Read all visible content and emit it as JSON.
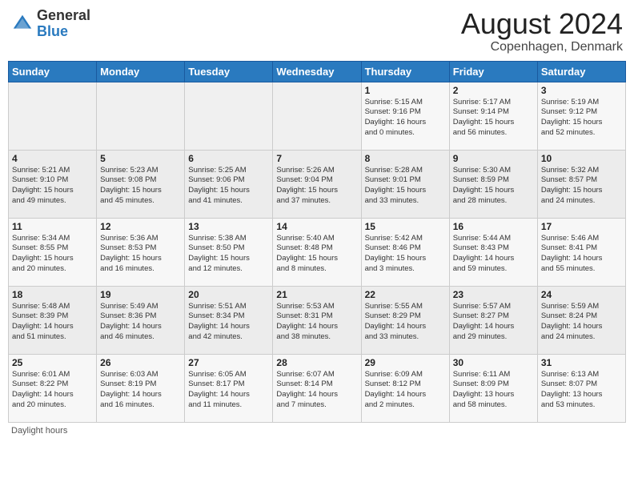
{
  "header": {
    "logo_general": "General",
    "logo_blue": "Blue",
    "month_year": "August 2024",
    "location": "Copenhagen, Denmark"
  },
  "days_of_week": [
    "Sunday",
    "Monday",
    "Tuesday",
    "Wednesday",
    "Thursday",
    "Friday",
    "Saturday"
  ],
  "weeks": [
    [
      {
        "day": "",
        "info": ""
      },
      {
        "day": "",
        "info": ""
      },
      {
        "day": "",
        "info": ""
      },
      {
        "day": "",
        "info": ""
      },
      {
        "day": "1",
        "info": "Sunrise: 5:15 AM\nSunset: 9:16 PM\nDaylight: 16 hours\nand 0 minutes."
      },
      {
        "day": "2",
        "info": "Sunrise: 5:17 AM\nSunset: 9:14 PM\nDaylight: 15 hours\nand 56 minutes."
      },
      {
        "day": "3",
        "info": "Sunrise: 5:19 AM\nSunset: 9:12 PM\nDaylight: 15 hours\nand 52 minutes."
      }
    ],
    [
      {
        "day": "4",
        "info": "Sunrise: 5:21 AM\nSunset: 9:10 PM\nDaylight: 15 hours\nand 49 minutes."
      },
      {
        "day": "5",
        "info": "Sunrise: 5:23 AM\nSunset: 9:08 PM\nDaylight: 15 hours\nand 45 minutes."
      },
      {
        "day": "6",
        "info": "Sunrise: 5:25 AM\nSunset: 9:06 PM\nDaylight: 15 hours\nand 41 minutes."
      },
      {
        "day": "7",
        "info": "Sunrise: 5:26 AM\nSunset: 9:04 PM\nDaylight: 15 hours\nand 37 minutes."
      },
      {
        "day": "8",
        "info": "Sunrise: 5:28 AM\nSunset: 9:01 PM\nDaylight: 15 hours\nand 33 minutes."
      },
      {
        "day": "9",
        "info": "Sunrise: 5:30 AM\nSunset: 8:59 PM\nDaylight: 15 hours\nand 28 minutes."
      },
      {
        "day": "10",
        "info": "Sunrise: 5:32 AM\nSunset: 8:57 PM\nDaylight: 15 hours\nand 24 minutes."
      }
    ],
    [
      {
        "day": "11",
        "info": "Sunrise: 5:34 AM\nSunset: 8:55 PM\nDaylight: 15 hours\nand 20 minutes."
      },
      {
        "day": "12",
        "info": "Sunrise: 5:36 AM\nSunset: 8:53 PM\nDaylight: 15 hours\nand 16 minutes."
      },
      {
        "day": "13",
        "info": "Sunrise: 5:38 AM\nSunset: 8:50 PM\nDaylight: 15 hours\nand 12 minutes."
      },
      {
        "day": "14",
        "info": "Sunrise: 5:40 AM\nSunset: 8:48 PM\nDaylight: 15 hours\nand 8 minutes."
      },
      {
        "day": "15",
        "info": "Sunrise: 5:42 AM\nSunset: 8:46 PM\nDaylight: 15 hours\nand 3 minutes."
      },
      {
        "day": "16",
        "info": "Sunrise: 5:44 AM\nSunset: 8:43 PM\nDaylight: 14 hours\nand 59 minutes."
      },
      {
        "day": "17",
        "info": "Sunrise: 5:46 AM\nSunset: 8:41 PM\nDaylight: 14 hours\nand 55 minutes."
      }
    ],
    [
      {
        "day": "18",
        "info": "Sunrise: 5:48 AM\nSunset: 8:39 PM\nDaylight: 14 hours\nand 51 minutes."
      },
      {
        "day": "19",
        "info": "Sunrise: 5:49 AM\nSunset: 8:36 PM\nDaylight: 14 hours\nand 46 minutes."
      },
      {
        "day": "20",
        "info": "Sunrise: 5:51 AM\nSunset: 8:34 PM\nDaylight: 14 hours\nand 42 minutes."
      },
      {
        "day": "21",
        "info": "Sunrise: 5:53 AM\nSunset: 8:31 PM\nDaylight: 14 hours\nand 38 minutes."
      },
      {
        "day": "22",
        "info": "Sunrise: 5:55 AM\nSunset: 8:29 PM\nDaylight: 14 hours\nand 33 minutes."
      },
      {
        "day": "23",
        "info": "Sunrise: 5:57 AM\nSunset: 8:27 PM\nDaylight: 14 hours\nand 29 minutes."
      },
      {
        "day": "24",
        "info": "Sunrise: 5:59 AM\nSunset: 8:24 PM\nDaylight: 14 hours\nand 24 minutes."
      }
    ],
    [
      {
        "day": "25",
        "info": "Sunrise: 6:01 AM\nSunset: 8:22 PM\nDaylight: 14 hours\nand 20 minutes."
      },
      {
        "day": "26",
        "info": "Sunrise: 6:03 AM\nSunset: 8:19 PM\nDaylight: 14 hours\nand 16 minutes."
      },
      {
        "day": "27",
        "info": "Sunrise: 6:05 AM\nSunset: 8:17 PM\nDaylight: 14 hours\nand 11 minutes."
      },
      {
        "day": "28",
        "info": "Sunrise: 6:07 AM\nSunset: 8:14 PM\nDaylight: 14 hours\nand 7 minutes."
      },
      {
        "day": "29",
        "info": "Sunrise: 6:09 AM\nSunset: 8:12 PM\nDaylight: 14 hours\nand 2 minutes."
      },
      {
        "day": "30",
        "info": "Sunrise: 6:11 AM\nSunset: 8:09 PM\nDaylight: 13 hours\nand 58 minutes."
      },
      {
        "day": "31",
        "info": "Sunrise: 6:13 AM\nSunset: 8:07 PM\nDaylight: 13 hours\nand 53 minutes."
      }
    ]
  ],
  "footer": "Daylight hours"
}
